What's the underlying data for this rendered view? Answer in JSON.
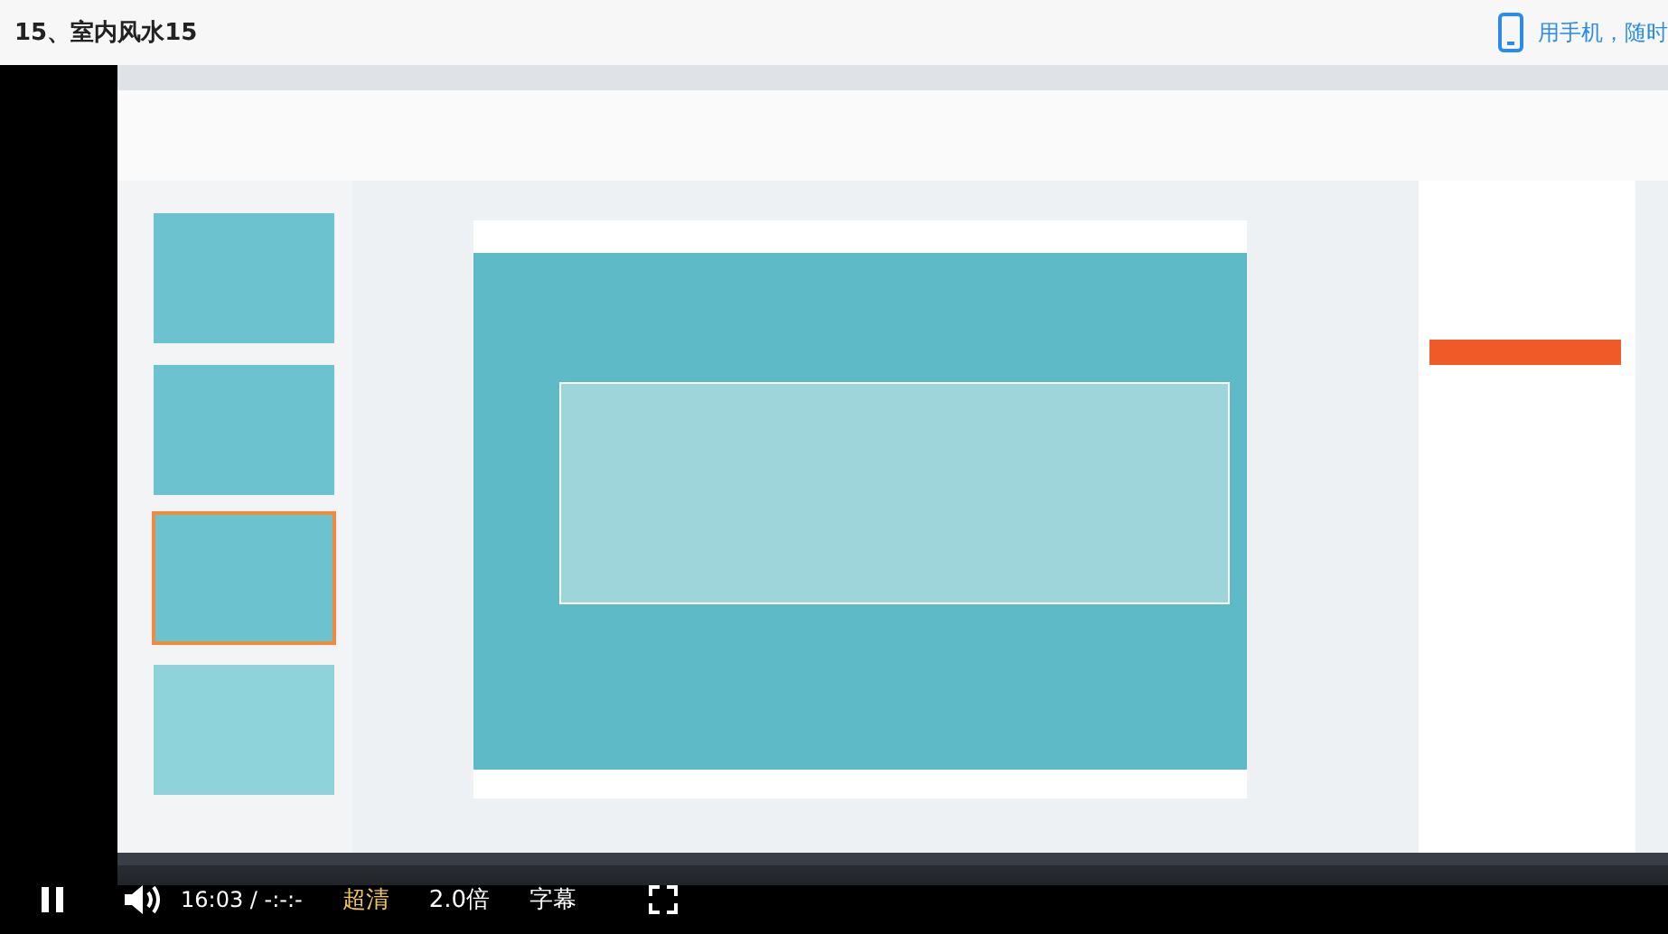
{
  "page": {
    "title": "15、室内风水15"
  },
  "promo": {
    "text": "用手机，随时"
  },
  "player": {
    "playing": true,
    "time": "16:03 / -:-:-",
    "quality": "超清",
    "speed": "2.0倍",
    "subtitles": "字幕"
  }
}
